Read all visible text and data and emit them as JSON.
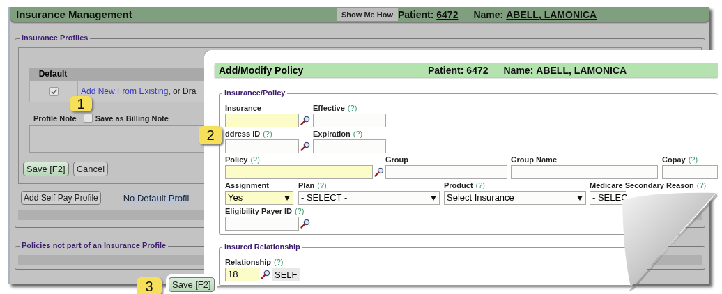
{
  "header": {
    "title": "Insurance Management",
    "help_button": "Show Me How",
    "patient_label": "Patient:",
    "patient_id": "6472",
    "name_label": "Name:",
    "name": "ABELL, LAMONICA"
  },
  "insurance_profiles": {
    "legend": "Insurance Profiles",
    "table": {
      "columns": [
        "Default"
      ],
      "rows": [
        {
          "default_checked": true,
          "parts": [
            {
              "kind": "link",
              "text": "Add New"
            },
            {
              "kind": "text",
              "text": ","
            },
            {
              "kind": "link",
              "text": "From Existing"
            },
            {
              "kind": "text",
              "text": ", or Dra"
            }
          ]
        }
      ]
    },
    "profile_note_label": "Profile Note",
    "billing_note": {
      "label": "Save as Billing Note",
      "checked": false
    },
    "buttons": [
      {
        "label": "Save [F2]",
        "primary": true
      },
      {
        "label": "Cancel",
        "primary": false
      }
    ],
    "self_pay_button": "Add Self Pay Profile",
    "status": "No Default Profil"
  },
  "other_policies": {
    "legend": "Policies not part of an Insurance Profile"
  },
  "dialog": {
    "title": "Add/Modify Policy",
    "patient_label": "Patient:",
    "patient_id": "6472",
    "name_label": "Name:",
    "name": "ABELL, LAMONICA",
    "sections": [
      {
        "legend": "Insurance/Policy",
        "rows": [
          [
            {
              "label": "Insurance",
              "kind": "lookup",
              "required": true
            },
            {
              "label": "Effective",
              "help": "(?)",
              "kind": "text",
              "required": false
            }
          ],
          [
            {
              "label": "ddress ID",
              "help": "(?)",
              "kind": "lookup",
              "required": false
            },
            {
              "label": "Expiration",
              "help": "(?)",
              "kind": "text",
              "required": false
            }
          ],
          [
            {
              "label": "Policy",
              "help": "(?)",
              "kind": "lookup",
              "required": true
            },
            {
              "label": "Group",
              "kind": "text",
              "required": false
            },
            {
              "label": "Group Name",
              "kind": "text",
              "required": false
            },
            {
              "label": "Copay",
              "help": "(?)",
              "kind": "text",
              "required": false
            }
          ],
          [
            {
              "label": "Assignment",
              "kind": "select",
              "value": "Yes",
              "required": true
            },
            {
              "label": "Plan",
              "help": "(?)",
              "kind": "select",
              "value": "- SELECT -",
              "required": false
            },
            {
              "label": "Product",
              "help": "(?)",
              "kind": "select",
              "value": "Select Insurance",
              "required": false
            },
            {
              "label": "Medicare Secondary Reason",
              "help": "(?)",
              "kind": "cut-select",
              "value": "- SELEC",
              "required": false
            }
          ],
          [
            {
              "label": "Eligibility Payer ID",
              "help": "(?)",
              "kind": "lookup",
              "required": false
            }
          ]
        ]
      },
      {
        "legend": "Insured Relationship",
        "rows": [
          [
            {
              "label": "Relationship",
              "help": "(?)",
              "kind": "lookup",
              "value": "18",
              "description": "SELF",
              "required": true
            }
          ]
        ]
      }
    ],
    "save_button": "Save [F2]"
  },
  "callouts": [
    {
      "number": "1"
    },
    {
      "number": "2"
    },
    {
      "number": "3"
    }
  ]
}
